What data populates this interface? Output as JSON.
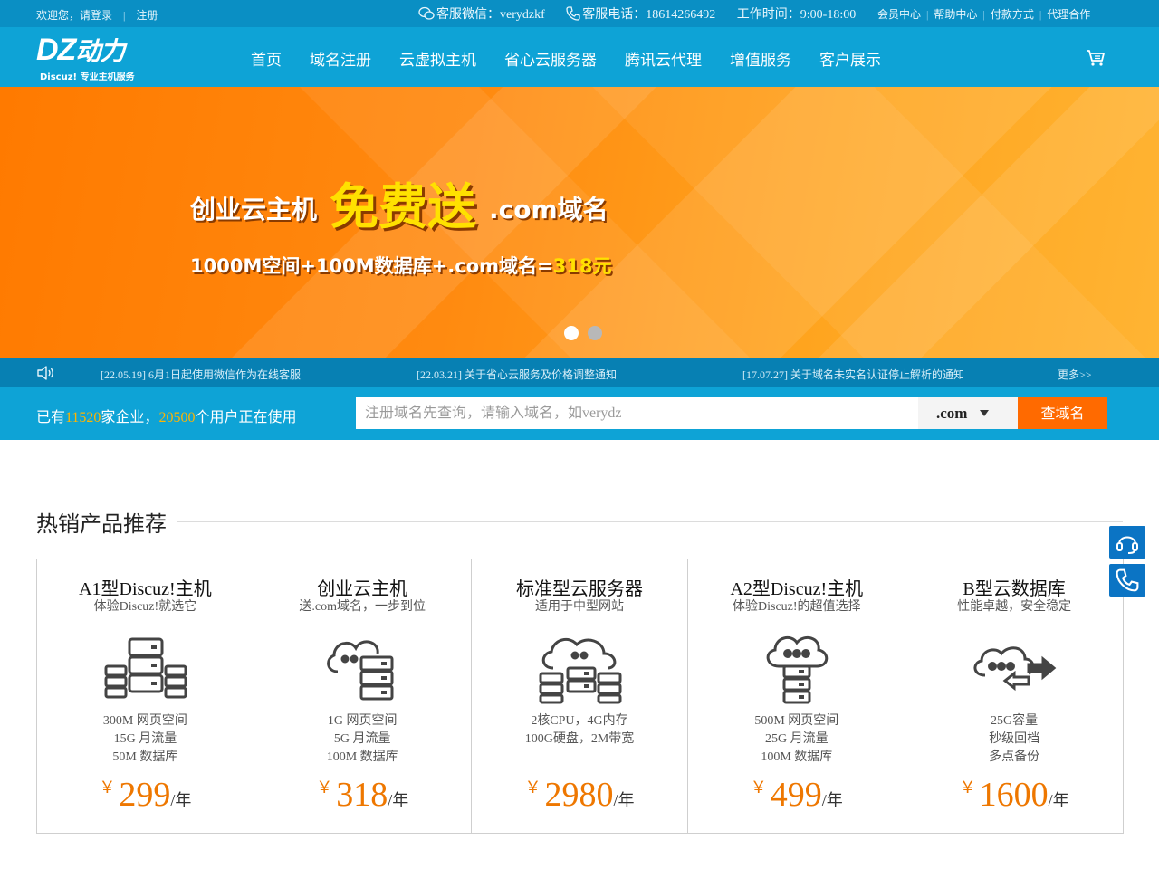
{
  "topbar": {
    "welcome": "欢迎您，请登录",
    "register": "注册",
    "wechat": "客服微信：verydzkf",
    "phone": "客服电话：18614266492",
    "hours": "工作时间：9:00-18:00",
    "links": [
      "会员中心",
      "帮助中心",
      "付款方式",
      "代理合作"
    ]
  },
  "logo": {
    "mark": "DZ",
    "mark_cn": "动力",
    "sub": "Discuz! 专业主机服务"
  },
  "nav": [
    "首页",
    "域名注册",
    "云虚拟主机",
    "省心云服务器",
    "腾讯云代理",
    "增值服务",
    "客户展示"
  ],
  "banner": {
    "part1": "创业云主机",
    "part2": "免费送",
    "part3": ".com域名",
    "line2_main": "1000M空间+100M数据库+.com域名=",
    "line2_price": "318元",
    "slides": 2,
    "active_slide": 1
  },
  "notices": [
    "[22.05.19] 6月1日起使用微信作为在线客服",
    "[22.03.21] 关于省心云服务及价格调整通知",
    "[17.07.27] 关于域名未实名认证停止解析的通知"
  ],
  "notice_more": "更多>>",
  "stat": {
    "pre": "已有",
    "companies": "11520",
    "mid": "家企业，",
    "users": "20500",
    "post": "个用户正在使用"
  },
  "search": {
    "placeholder": "注册域名先查询，请输入域名，如verydz",
    "suffix": ".com",
    "button": "查域名"
  },
  "section_title": "热销产品推荐",
  "products": [
    {
      "name": "A1型Discuz!主机",
      "desc": "体验Discuz!就选它",
      "icon": "server-cluster-icon",
      "specs": [
        "300M 网页空间",
        "15G 月流量",
        "50M 数据库"
      ],
      "price": "299",
      "unit": "/年"
    },
    {
      "name": "创业云主机",
      "desc": "送.com域名，一步到位",
      "icon": "cloud-server-icon",
      "specs": [
        "1G 网页空间",
        "5G 月流量",
        "100M 数据库"
      ],
      "price": "318",
      "unit": "/年"
    },
    {
      "name": "标准型云服务器",
      "desc": "适用于中型网站",
      "icon": "cloud-server-cluster-icon",
      "specs": [
        "2核CPU，4G内存",
        "100G硬盘，2M带宽"
      ],
      "price": "2980",
      "unit": "/年"
    },
    {
      "name": "A2型Discuz!主机",
      "desc": "体验Discuz!的超值选择",
      "icon": "cloud-host-icon",
      "specs": [
        "500M 网页空间",
        "25G 月流量",
        "100M 数据库"
      ],
      "price": "499",
      "unit": "/年"
    },
    {
      "name": "B型云数据库",
      "desc": "性能卓越，安全稳定",
      "icon": "cloud-database-icon",
      "specs": [
        "25G容量",
        "秒级回档",
        "多点备份"
      ],
      "price": "1600",
      "unit": "/年"
    }
  ],
  "currency": "￥",
  "colors": {
    "primary": "#0ea3d6",
    "topbar": "#0a8fc4",
    "accent": "#ff6a00",
    "price": "#ee7700",
    "float": "#0b74c4"
  }
}
